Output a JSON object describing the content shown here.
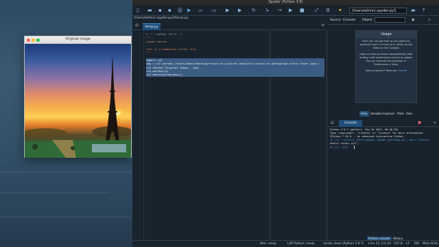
{
  "image_window": {
    "title": "Original image"
  },
  "spyder": {
    "title": "Spyder (Python 3.9)",
    "working_dir": "/Users/admin/.spyder-py3",
    "editor": {
      "path": "/Users/admin/.spyder-py3/temp.py",
      "tab": "temp.py",
      "lines": [
        {
          "text": "# -*- coding: utf-8 -*-",
          "kind": "cmt"
        },
        {
          "text": "\"\"\"",
          "kind": "doc"
        },
        {
          "text": "Spyder Editor",
          "kind": "doc"
        },
        {
          "text": "",
          "kind": "doc"
        },
        {
          "text": "This is a temporary script file.",
          "kind": "doc"
        },
        {
          "text": "\"\"\"",
          "kind": "doc"
        },
        {
          "text": "",
          "kind": "plain"
        },
        {
          "text": "import cv2",
          "kind": "sel"
        },
        {
          "text": "img = cv2.imread('/Users/admin/Desktop/france-in-pictures-beautiful-places-to-photograph-eiffel-tower.jpeg')",
          "kind": "sel"
        },
        {
          "text": "cv2.imshow('Original Image', img)",
          "kind": "sel"
        },
        {
          "text": "cv2.waitKey(0)",
          "kind": "sel"
        },
        {
          "text": "cv2.destroyAllWindows()",
          "kind": "sel"
        }
      ]
    },
    "right_tabs": {
      "source": "Source",
      "console": "Console",
      "object": "Object"
    },
    "help": {
      "heading": "Usage",
      "p1": "Here you can get help of any object by pressing Cmd+I in front of it, either on the Editor or the Console.",
      "p2": "Help can also be shown automatically after writing a left parenthesis next to an object. You can activate this behavior in Preferences > Help.",
      "p3_prefix": "New to Spyder? Read our",
      "p3_link": "tutorial"
    },
    "pane_tabs": [
      "Help",
      "Variable Explorer",
      "Plots",
      "Files"
    ],
    "console": {
      "tab": "Console 1/A",
      "lines": [
        {
          "text": "Python 3.9.7 (default, Sep 16 2021, 08:50:36)",
          "kind": "plain"
        },
        {
          "text": "Type \"copyright\", \"credits\" or \"license\" for more information.",
          "kind": "plain"
        },
        {
          "text": "",
          "kind": "plain"
        },
        {
          "text": "IPython 7.29.0 -- An enhanced Interactive Python.",
          "kind": "plain"
        },
        {
          "text": "",
          "kind": "plain"
        },
        {
          "text": "In [1]: runfile('/Users/admin/.spyder-py3/temp.py', wdir='/Users/",
          "kind": "in"
        },
        {
          "text": "admin/.spyder-py3')",
          "kind": "ital"
        },
        {
          "text": "",
          "kind": "plain"
        },
        {
          "text": "In [2]: exit",
          "kind": "in"
        }
      ],
      "bottom_tabs": [
        "IPython console",
        "History"
      ]
    },
    "status": {
      "kite": "Kite: ready",
      "lsp": "LSP Python: ready",
      "conda": "conda: base (Python 3.9.7)",
      "position": "Line 12, Col 24",
      "encoding": "UTF-8",
      "eol": "LF",
      "rw": "RW",
      "mem": "Mem 65%"
    }
  }
}
